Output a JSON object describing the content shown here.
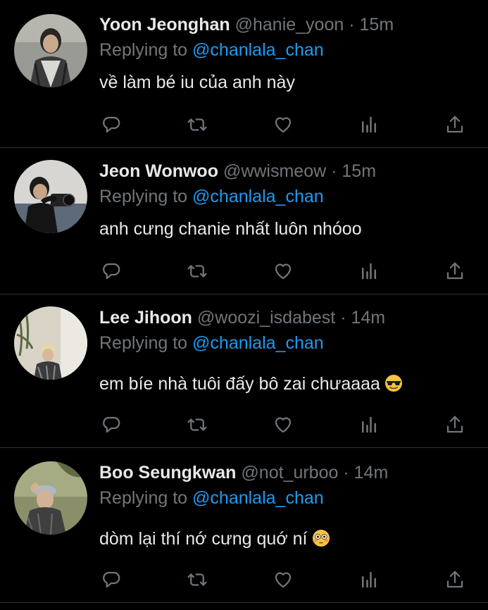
{
  "colors": {
    "background": "#000000",
    "name": "#e7e9ea",
    "muted": "#71767b",
    "link": "#1d9bf0",
    "divider": "#2f3336"
  },
  "replies": [
    {
      "name": "Yoon Jeonghan",
      "handle": "@hanie_yoon",
      "dot": "·",
      "time": "15m",
      "replying_prefix": "Replying to ",
      "replying_to": "@chanlala_chan",
      "text": "về làm bé iu của anh này",
      "emoji": "",
      "avatar": "avatar-photo-jeonghan"
    },
    {
      "name": "Jeon Wonwoo",
      "handle": "@wwismeow",
      "dot": "·",
      "time": "15m",
      "replying_prefix": "Replying to ",
      "replying_to": "@chanlala_chan",
      "text": "anh cưng chanie nhất luôn nhóoo",
      "emoji": "",
      "avatar": "avatar-photo-wonwoo"
    },
    {
      "name": "Lee Jihoon",
      "handle": "@woozi_isdabest",
      "dot": "·",
      "time": "14m",
      "replying_prefix": "Replying to ",
      "replying_to": "@chanlala_chan",
      "text": "em bíe nhà tuôi đấy bô zai chưaaaa",
      "emoji": "sunglasses-emoji",
      "avatar": "avatar-photo-jihoon"
    },
    {
      "name": "Boo Seungkwan",
      "handle": "@not_urboo",
      "dot": "·",
      "time": "14m",
      "replying_prefix": "Replying to ",
      "replying_to": "@chanlala_chan",
      "text": "dòm lại thí nớ cưng quớ ní",
      "emoji": "flushed-emoji",
      "avatar": "avatar-photo-seungkwan"
    }
  ],
  "action_icons": [
    "reply-icon",
    "retweet-icon",
    "like-icon",
    "analytics-icon",
    "share-icon"
  ]
}
